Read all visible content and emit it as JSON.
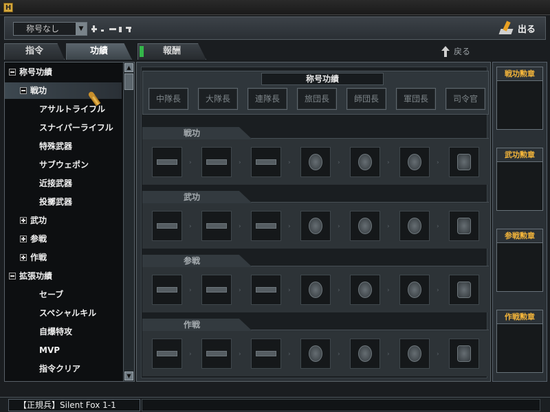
{
  "app": {
    "icon_label": "H"
  },
  "topbar": {
    "title_select_value": "称号なし",
    "exit_label": "出る"
  },
  "tabs": [
    {
      "label": "指令",
      "active": false
    },
    {
      "label": "功績",
      "active": true
    },
    {
      "label": "報酬",
      "active": false
    }
  ],
  "back_label": "戻る",
  "tree": {
    "items": [
      {
        "label": "称号功績",
        "level": 0,
        "expand": "minus"
      },
      {
        "label": "戦功",
        "level": 1,
        "expand": "minus",
        "selected": true
      },
      {
        "label": "アサルトライフル",
        "level": 2
      },
      {
        "label": "スナイパーライフル",
        "level": 2
      },
      {
        "label": "特殊武器",
        "level": 2
      },
      {
        "label": "サブウェポン",
        "level": 2
      },
      {
        "label": "近接武器",
        "level": 2
      },
      {
        "label": "投擲武器",
        "level": 2
      },
      {
        "label": "武功",
        "level": 1,
        "expand": "plus"
      },
      {
        "label": "参戦",
        "level": 1,
        "expand": "plus"
      },
      {
        "label": "作戦",
        "level": 1,
        "expand": "plus"
      },
      {
        "label": "拡張功績",
        "level": 0,
        "expand": "minus"
      },
      {
        "label": "セーブ",
        "level": 2
      },
      {
        "label": "スペシャルキル",
        "level": 2
      },
      {
        "label": "自爆特攻",
        "level": 2
      },
      {
        "label": "MVP",
        "level": 2
      },
      {
        "label": "指令クリア",
        "level": 2
      }
    ]
  },
  "main": {
    "rank_title": "称号功績",
    "ranks": [
      "中隊長",
      "大隊長",
      "連隊長",
      "旅団長",
      "師団長",
      "軍団長",
      "司令官"
    ],
    "sections": [
      {
        "title": "戦功",
        "medals": [
          "ribbon",
          "ribbon",
          "ribbon",
          "medal",
          "medal",
          "medal",
          "medal-wing"
        ]
      },
      {
        "title": "武功",
        "medals": [
          "ribbon",
          "ribbon",
          "ribbon",
          "medal",
          "medal",
          "medal",
          "medal-wing"
        ]
      },
      {
        "title": "参戦",
        "medals": [
          "ribbon",
          "ribbon",
          "ribbon",
          "medal",
          "medal",
          "medal",
          "medal-wing"
        ]
      },
      {
        "title": "作戦",
        "medals": [
          "ribbon",
          "ribbon",
          "ribbon",
          "medal",
          "medal",
          "medal",
          "medal-wing"
        ]
      }
    ]
  },
  "right": {
    "badges": [
      "戦功勲章",
      "武功勲章",
      "参戦勲章",
      "作戦勲章"
    ]
  },
  "status": {
    "player": "【正規兵】Silent Fox 1-1"
  },
  "colors": {
    "accent": "#f2b43a",
    "tab_green": "#34b64a",
    "bullet": "#e0a63a"
  }
}
